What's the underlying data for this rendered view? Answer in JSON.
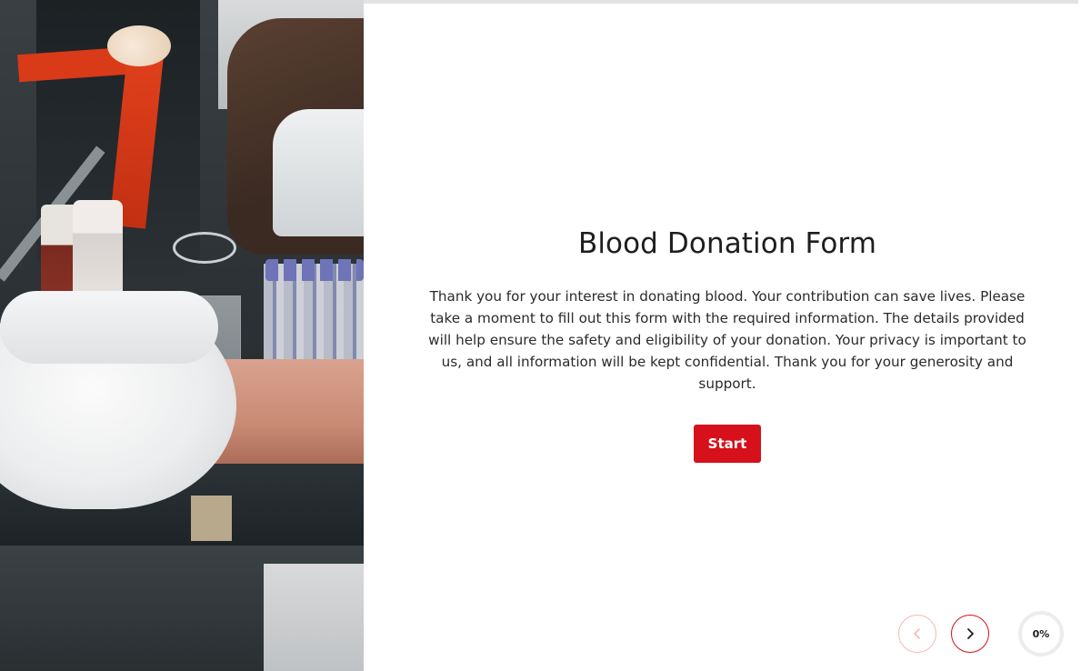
{
  "form": {
    "title": "Blood Donation Form",
    "description": "Thank you for your interest in donating blood. Your contribution can save lives. Please take a moment to fill out this form with the required information. The details provided will help ensure the safety and eligibility of your donation. Your privacy is important to us, and all information will be kept confidential. Thank you for your generosity and support.",
    "start_label": "Start"
  },
  "navigation": {
    "prev_icon": "chevron-left-icon",
    "next_icon": "chevron-right-icon",
    "prev_enabled": false,
    "next_enabled": true
  },
  "progress": {
    "percent_label": "0%",
    "percent_value": 0
  },
  "colors": {
    "accent": "#d6111b",
    "accent_disabled": "#f0b9bb",
    "text": "#1e1e1e",
    "track": "#e3e3e3"
  },
  "hero_image": {
    "icon": "blood-donation-photo"
  }
}
